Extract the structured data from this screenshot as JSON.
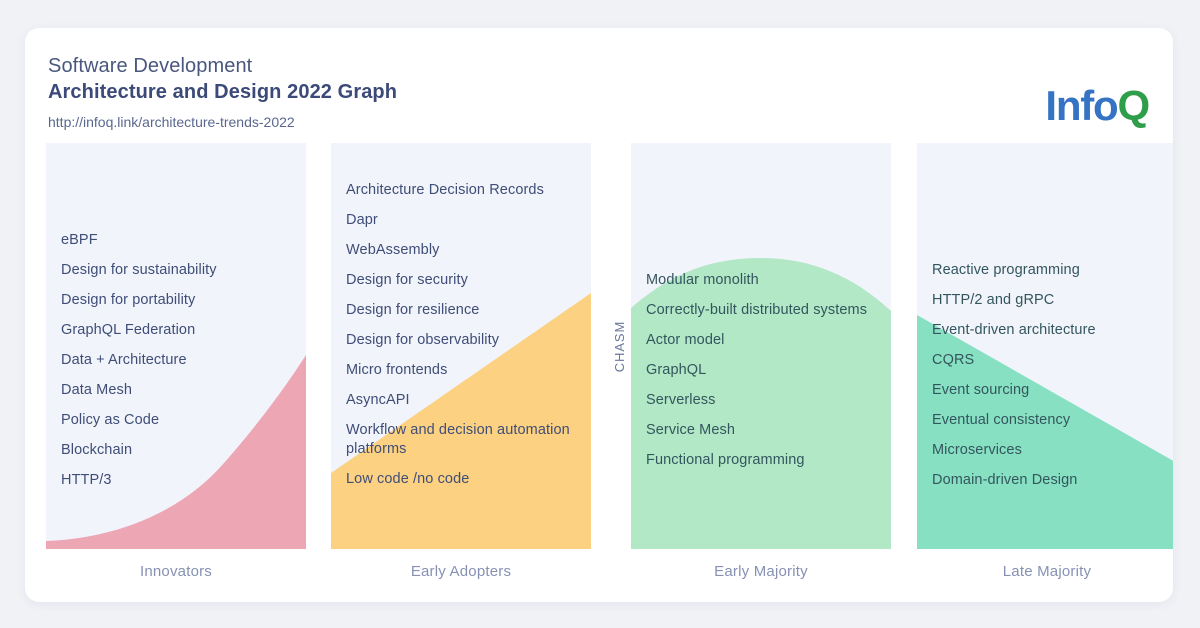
{
  "page": {
    "background": "#f1f2f6",
    "card_background": "#ffffff"
  },
  "header": {
    "title_line1": "Software Development",
    "title_line2": "Architecture and Design 2022 Graph",
    "link": "http://infoq.link/architecture-trends-2022",
    "logo_primary": "Info",
    "logo_accent": "Q",
    "logo_primary_color": "#3573c4",
    "logo_accent_color": "#2e9e4a"
  },
  "chasm_label": "CHASM",
  "chart_data": {
    "type": "area",
    "title": "Software Development Architecture and Design 2022 Graph",
    "xlabel": "",
    "ylabel": "",
    "legend_position": "none",
    "grid": false,
    "categories": [
      "Innovators",
      "Early Adopters",
      "Early Majority",
      "Late Majority"
    ],
    "annotations": [
      "CHASM"
    ],
    "series": [
      {
        "name": "Innovators",
        "color": "#eda7b4",
        "band_background": "#f2f4fb",
        "shape": "rising-exponential",
        "values": [
          "eBPF",
          "Design for sustainability",
          "Design for portability",
          "GraphQL Federation",
          "Data + Architecture",
          "Data Mesh",
          "Policy as Code",
          "Blockchain",
          "HTTP/3"
        ]
      },
      {
        "name": "Early Adopters",
        "color": "#fcd182",
        "band_background": "#f2f4fb",
        "shape": "rising-diagonal",
        "values": [
          "Architecture Decision Records",
          "Dapr",
          "WebAssembly",
          "Design for security",
          "Design for resilience",
          "Design for observability",
          "Micro frontends",
          "AsyncAPI",
          "Workflow and decision automation platforms",
          "Low code /no code"
        ]
      },
      {
        "name": "Early Majority",
        "color": "#b2e8c6",
        "band_background": "#f2f4fb",
        "shape": "peak-hump",
        "values": [
          "Modular monolith",
          "Correctly-built distributed systems",
          "Actor model",
          "GraphQL",
          "Serverless",
          "Service Mesh",
          "Functional programming"
        ]
      },
      {
        "name": "Late Majority",
        "color": "#87e0c2",
        "band_background": "#f2f4fb",
        "shape": "falling-diagonal",
        "values": [
          "Reactive programming",
          "HTTP/2 and gRPC",
          "Event-driven architecture",
          "CQRS",
          "Event sourcing",
          "Eventual consistency",
          "Microservices",
          "Domain-driven Design"
        ]
      }
    ]
  }
}
